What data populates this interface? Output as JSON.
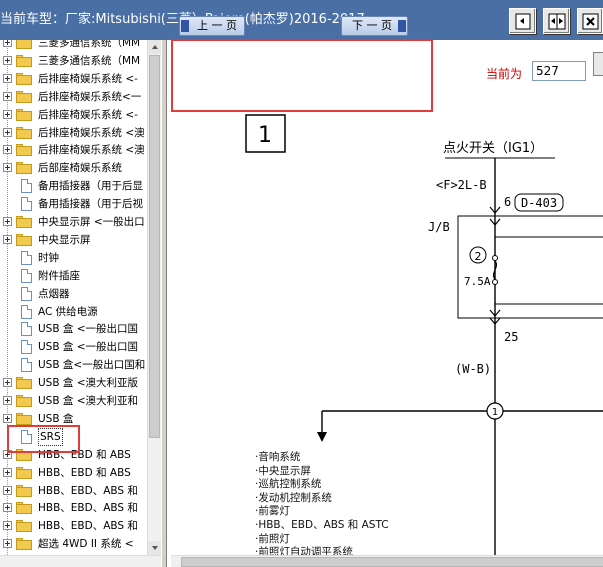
{
  "window": {
    "title": "当前车型：厂家:Mitsubishi(三菱）Pajero(帕杰罗)2016-2017"
  },
  "toolbar": {
    "buttons": [
      "fit-page-icon",
      "fit-width-icon",
      "close-icon"
    ]
  },
  "tree": {
    "items": [
      {
        "label": "三菱多通信系统（MM",
        "type": "folder",
        "expandable": true
      },
      {
        "label": "三菱多通信系统（MM",
        "type": "folder",
        "expandable": true
      },
      {
        "label": "后排座椅娱乐系统 <-",
        "type": "folder",
        "expandable": true
      },
      {
        "label": "后排座椅娱乐系统<一",
        "type": "folder",
        "expandable": true
      },
      {
        "label": "后排座椅娱乐系统 <-",
        "type": "folder",
        "expandable": true
      },
      {
        "label": "后排座椅娱乐系统 <澳",
        "type": "folder",
        "expandable": true
      },
      {
        "label": "后排座椅娱乐系统 <澳",
        "type": "folder",
        "expandable": true
      },
      {
        "label": "后部座椅娱乐系统",
        "type": "folder",
        "expandable": true
      },
      {
        "label": "备用插接器（用于后显",
        "type": "doc",
        "expandable": false
      },
      {
        "label": "备用插接器（用于后视",
        "type": "doc",
        "expandable": false
      },
      {
        "label": "中央显示屏 <一般出口",
        "type": "folder",
        "expandable": true
      },
      {
        "label": "中央显示屏",
        "type": "folder",
        "expandable": true
      },
      {
        "label": "时钟",
        "type": "doc",
        "expandable": false
      },
      {
        "label": "附件插座",
        "type": "doc",
        "expandable": false
      },
      {
        "label": "点烟器",
        "type": "doc",
        "expandable": false
      },
      {
        "label": "AC 供给电源",
        "type": "doc",
        "expandable": false
      },
      {
        "label": "USB 盒 <一般出口国",
        "type": "doc",
        "expandable": false
      },
      {
        "label": "USB 盒 <一般出口国",
        "type": "doc",
        "expandable": false
      },
      {
        "label": "USB 盒<一般出口国和",
        "type": "doc",
        "expandable": false
      },
      {
        "label": "USB 盒 <澳大利亚版",
        "type": "folder",
        "expandable": true
      },
      {
        "label": "USB 盒 <澳大利亚和",
        "type": "folder",
        "expandable": true
      },
      {
        "label": "USB 盒",
        "type": "folder",
        "expandable": true
      },
      {
        "label": "SRS",
        "type": "doc",
        "expandable": false,
        "selected": true
      },
      {
        "label": "HBB、EBD 和 ABS",
        "type": "folder",
        "expandable": true
      },
      {
        "label": "HBB、EBD 和 ABS",
        "type": "folder",
        "expandable": true
      },
      {
        "label": "HBB、EBD、ABS 和",
        "type": "folder",
        "expandable": true
      },
      {
        "label": "HBB、EBD、ABS 和",
        "type": "folder",
        "expandable": true
      },
      {
        "label": "HBB、EBD、ABS 和",
        "type": "folder",
        "expandable": true
      },
      {
        "label": "超选 4WD II 系统 <",
        "type": "folder",
        "expandable": true
      }
    ]
  },
  "nav": {
    "prev_label": "上 一 页",
    "next_label": "下 一 页",
    "current_page_label": "当前为",
    "current_page_value": "527"
  },
  "diagram": {
    "page_number": "1",
    "switch_label": "点火开关（IG1）",
    "wire_f_label": "<F>2L-B",
    "pin_6": "6",
    "connector_d403": "D-403",
    "jb_label": "J/B",
    "fuse_number": "2",
    "fuse_rating": "7.5A",
    "pin_25": "25",
    "wire_wb": "(W-B)",
    "junction_1": "1",
    "systems": [
      "·音响系统",
      "·中央显示屏",
      "·巡航控制系统",
      "·发动机控制系统",
      "·前雾灯",
      "·HBB、EBD、ABS 和 ASTC",
      "·前照灯",
      "·前照灯自动调平系统"
    ]
  },
  "colors": {
    "title_bar": "#4a6fa5",
    "highlight_red": "#e23b3b",
    "current_page_label": "#d00000",
    "nav_button": "#b9cbe8"
  }
}
